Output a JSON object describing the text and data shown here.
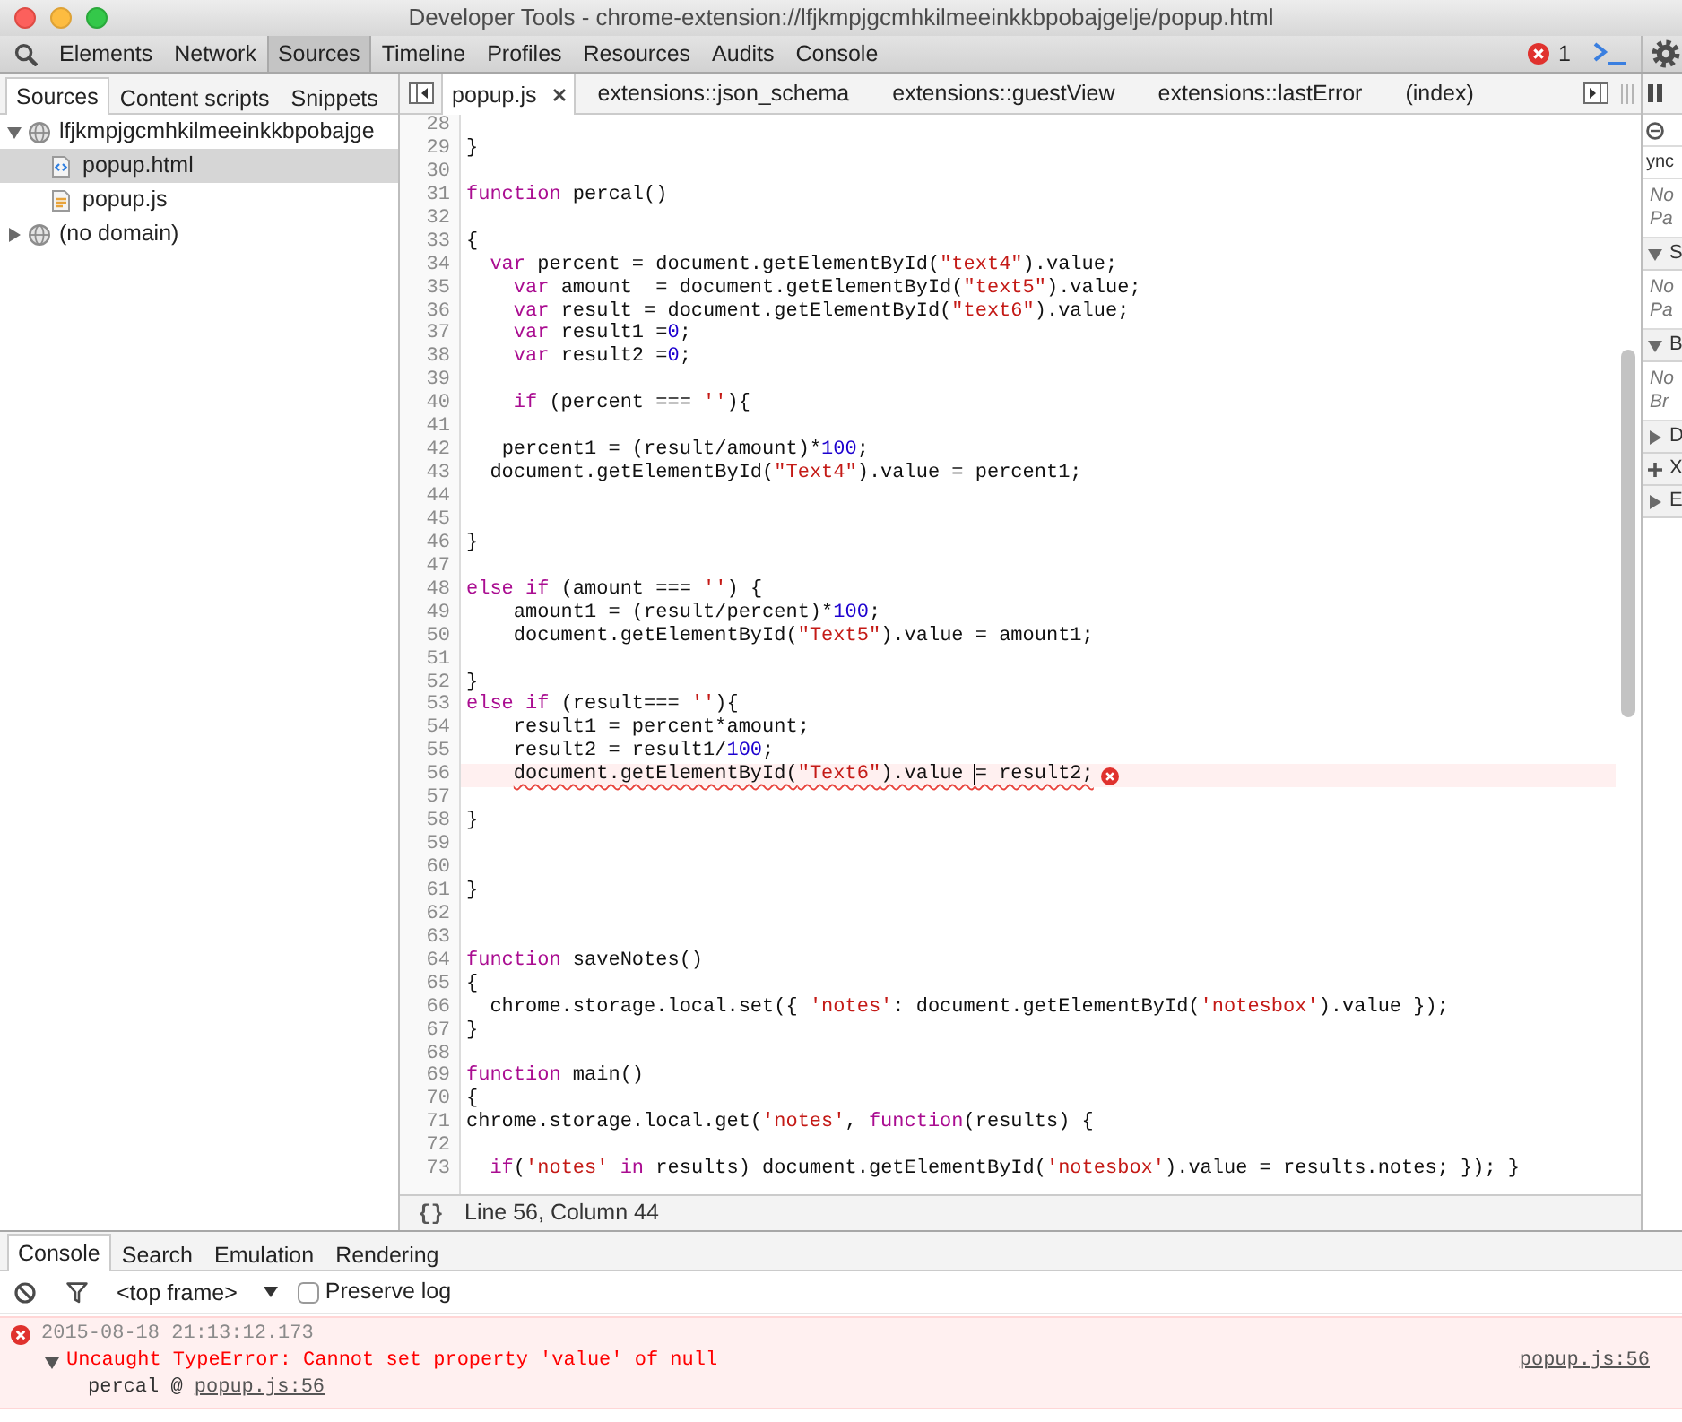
{
  "window": {
    "title": "Developer Tools - chrome-extension://lfjkmpjgcmhkilmeeinkkbpobajgelje/popup.html"
  },
  "toolbar": {
    "tabs": [
      {
        "label": "Elements",
        "selected": false
      },
      {
        "label": "Network",
        "selected": false
      },
      {
        "label": "Sources",
        "selected": true
      },
      {
        "label": "Timeline",
        "selected": false
      },
      {
        "label": "Profiles",
        "selected": false
      },
      {
        "label": "Resources",
        "selected": false
      },
      {
        "label": "Audits",
        "selected": false
      },
      {
        "label": "Console",
        "selected": false
      }
    ],
    "error_count": "1"
  },
  "navigator": {
    "tabs": [
      {
        "label": "Sources",
        "selected": true
      },
      {
        "label": "Content scripts",
        "selected": false
      },
      {
        "label": "Snippets",
        "selected": false
      }
    ],
    "tree": [
      {
        "label": "lfjkmpjgcmhkilmeeinkkbpobajge",
        "kind": "domain",
        "expanded": true,
        "selected": false,
        "children": [
          {
            "label": "popup.html",
            "kind": "html",
            "selected": true
          },
          {
            "label": "popup.js",
            "kind": "script",
            "selected": false
          }
        ]
      },
      {
        "label": "(no domain)",
        "kind": "domain",
        "expanded": false,
        "selected": false
      }
    ]
  },
  "editor": {
    "tabs": [
      {
        "label": "popup.js",
        "selected": true,
        "closable": true
      },
      {
        "label": "extensions::json_schema",
        "selected": false,
        "closable": false
      },
      {
        "label": "extensions::guestView",
        "selected": false,
        "closable": false
      },
      {
        "label": "extensions::lastError",
        "selected": false,
        "closable": false
      },
      {
        "label": "(index)",
        "selected": false,
        "closable": false
      }
    ],
    "lines": [
      {
        "number": "28",
        "error": false
      },
      {
        "number": "29",
        "error": false,
        "tokens": [
          {
            "kind": "plain",
            "text": "}"
          }
        ]
      },
      {
        "number": "30",
        "error": false
      },
      {
        "number": "31",
        "error": false,
        "tokens": [
          {
            "kind": "kw",
            "text": "function"
          },
          {
            "kind": "plain",
            "text": " percal()"
          }
        ]
      },
      {
        "number": "32",
        "error": false
      },
      {
        "number": "33",
        "error": false,
        "tokens": [
          {
            "kind": "plain",
            "text": "{"
          }
        ]
      },
      {
        "number": "34",
        "error": false,
        "tokens": [
          {
            "kind": "kw",
            "text": "  var"
          },
          {
            "kind": "plain",
            "text": " percent = document.getElementById("
          },
          {
            "kind": "str",
            "text": "\"text4\""
          },
          {
            "kind": "plain",
            "text": ").value;"
          }
        ]
      },
      {
        "number": "35",
        "error": false,
        "tokens": [
          {
            "kind": "kw",
            "text": "    var"
          },
          {
            "kind": "plain",
            "text": " amount  = document.getElementById("
          },
          {
            "kind": "str",
            "text": "\"text5\""
          },
          {
            "kind": "plain",
            "text": ").value;"
          }
        ]
      },
      {
        "number": "36",
        "error": false,
        "tokens": [
          {
            "kind": "kw",
            "text": "    var"
          },
          {
            "kind": "plain",
            "text": " result = document.getElementById("
          },
          {
            "kind": "str",
            "text": "\"text6\""
          },
          {
            "kind": "plain",
            "text": ").value;"
          }
        ]
      },
      {
        "number": "37",
        "error": false,
        "tokens": [
          {
            "kind": "kw",
            "text": "    var"
          },
          {
            "kind": "plain",
            "text": " result1 ="
          },
          {
            "kind": "num",
            "text": "0"
          },
          {
            "kind": "plain",
            "text": ";"
          }
        ]
      },
      {
        "number": "38",
        "error": false,
        "tokens": [
          {
            "kind": "kw",
            "text": "    var"
          },
          {
            "kind": "plain",
            "text": " result2 ="
          },
          {
            "kind": "num",
            "text": "0"
          },
          {
            "kind": "plain",
            "text": ";"
          }
        ]
      },
      {
        "number": "39",
        "error": false
      },
      {
        "number": "40",
        "error": false,
        "tokens": [
          {
            "kind": "kw",
            "text": "    if"
          },
          {
            "kind": "plain",
            "text": " (percent === "
          },
          {
            "kind": "str",
            "text": "''"
          },
          {
            "kind": "plain",
            "text": "){"
          }
        ]
      },
      {
        "number": "41",
        "error": false
      },
      {
        "number": "42",
        "error": false,
        "tokens": [
          {
            "kind": "plain",
            "text": "   percent1 = (result/amount)*"
          },
          {
            "kind": "num",
            "text": "100"
          },
          {
            "kind": "plain",
            "text": ";"
          }
        ]
      },
      {
        "number": "43",
        "error": false,
        "tokens": [
          {
            "kind": "plain",
            "text": "  document.getElementById("
          },
          {
            "kind": "str",
            "text": "\"Text4\""
          },
          {
            "kind": "plain",
            "text": ").value = percent1;"
          }
        ]
      },
      {
        "number": "44",
        "error": false
      },
      {
        "number": "45",
        "error": false
      },
      {
        "number": "46",
        "error": false,
        "tokens": [
          {
            "kind": "plain",
            "text": "}"
          }
        ]
      },
      {
        "number": "47",
        "error": false
      },
      {
        "number": "48",
        "error": false,
        "tokens": [
          {
            "kind": "kw",
            "text": "else if"
          },
          {
            "kind": "plain",
            "text": " (amount === "
          },
          {
            "kind": "str",
            "text": "''"
          },
          {
            "kind": "plain",
            "text": ") {"
          }
        ]
      },
      {
        "number": "49",
        "error": false,
        "tokens": [
          {
            "kind": "plain",
            "text": "    amount1 = (result/percent)*"
          },
          {
            "kind": "num",
            "text": "100"
          },
          {
            "kind": "plain",
            "text": ";"
          }
        ]
      },
      {
        "number": "50",
        "error": false,
        "tokens": [
          {
            "kind": "plain",
            "text": "    document.getElementById("
          },
          {
            "kind": "str",
            "text": "\"Text5\""
          },
          {
            "kind": "plain",
            "text": ").value = amount1;"
          }
        ]
      },
      {
        "number": "51",
        "error": false
      },
      {
        "number": "52",
        "error": false,
        "tokens": [
          {
            "kind": "plain",
            "text": "}"
          }
        ]
      },
      {
        "number": "53",
        "error": false,
        "tokens": [
          {
            "kind": "kw",
            "text": "else if"
          },
          {
            "kind": "plain",
            "text": " (result=== "
          },
          {
            "kind": "str",
            "text": "''"
          },
          {
            "kind": "plain",
            "text": "){"
          }
        ]
      },
      {
        "number": "54",
        "error": false,
        "tokens": [
          {
            "kind": "plain",
            "text": "    result1 = percent*amount;"
          }
        ]
      },
      {
        "number": "55",
        "error": false,
        "tokens": [
          {
            "kind": "plain",
            "text": "    result2 = result1/"
          },
          {
            "kind": "num",
            "text": "100"
          },
          {
            "kind": "plain",
            "text": ";"
          }
        ]
      },
      {
        "number": "56",
        "error": true,
        "tokens": [
          {
            "kind": "plain",
            "text": "    document.getElementById("
          },
          {
            "kind": "str",
            "text": "\"Text6\""
          },
          {
            "kind": "plain",
            "text": ").value "
          },
          {
            "kind": "plain",
            "text": "= result2;",
            "cursor": true
          }
        ]
      },
      {
        "number": "57",
        "error": false
      },
      {
        "number": "58",
        "error": false,
        "tokens": [
          {
            "kind": "plain",
            "text": "}"
          }
        ]
      },
      {
        "number": "59",
        "error": false
      },
      {
        "number": "60",
        "error": false
      },
      {
        "number": "61",
        "error": false,
        "tokens": [
          {
            "kind": "plain",
            "text": "}"
          }
        ]
      },
      {
        "number": "62",
        "error": false
      },
      {
        "number": "63",
        "error": false
      },
      {
        "number": "64",
        "error": false,
        "tokens": [
          {
            "kind": "kw",
            "text": "function"
          },
          {
            "kind": "plain",
            "text": " saveNotes()"
          }
        ]
      },
      {
        "number": "65",
        "error": false,
        "tokens": [
          {
            "kind": "plain",
            "text": "{"
          }
        ]
      },
      {
        "number": "66",
        "error": false,
        "tokens": [
          {
            "kind": "plain",
            "text": "  chrome.storage.local.set({ "
          },
          {
            "kind": "str",
            "text": "'notes'"
          },
          {
            "kind": "plain",
            "text": ": document.getElementById("
          },
          {
            "kind": "str",
            "text": "'notesbox'"
          },
          {
            "kind": "plain",
            "text": ").value });"
          }
        ]
      },
      {
        "number": "67",
        "error": false,
        "tokens": [
          {
            "kind": "plain",
            "text": "}"
          }
        ]
      },
      {
        "number": "68",
        "error": false
      },
      {
        "number": "69",
        "error": false,
        "tokens": [
          {
            "kind": "kw",
            "text": "function"
          },
          {
            "kind": "plain",
            "text": " main()"
          }
        ]
      },
      {
        "number": "70",
        "error": false,
        "tokens": [
          {
            "kind": "plain",
            "text": "{"
          }
        ]
      },
      {
        "number": "71",
        "error": false,
        "tokens": [
          {
            "kind": "plain",
            "text": "chrome.storage.local.get("
          },
          {
            "kind": "str",
            "text": "'notes'"
          },
          {
            "kind": "plain",
            "text": ", "
          },
          {
            "kind": "kw",
            "text": "function"
          },
          {
            "kind": "plain",
            "text": "(results) {"
          }
        ]
      },
      {
        "number": "72",
        "error": false
      },
      {
        "number": "73",
        "error": false,
        "tokens": [
          {
            "kind": "kw",
            "text": "  if"
          },
          {
            "kind": "plain",
            "text": "("
          },
          {
            "kind": "str",
            "text": "'notes'"
          },
          {
            "kind": "kw",
            "text": " in"
          },
          {
            "kind": "plain",
            "text": " results) document.getElementById("
          },
          {
            "kind": "str",
            "text": "'notesbox'"
          },
          {
            "kind": "plain",
            "text": ").value = results.notes; }); }"
          }
        ]
      }
    ],
    "format_button": "{}",
    "status": "Line 56, Column 44"
  },
  "sidebar": {
    "rows": [
      {
        "kind": "icon"
      },
      {
        "kind": "label",
        "text": "ync"
      },
      {
        "kind": "note",
        "lines": [
          "No",
          "Pa"
        ]
      },
      {
        "kind": "section",
        "expanded": true,
        "text": "S"
      },
      {
        "kind": "note",
        "lines": [
          "No",
          "Pa"
        ]
      },
      {
        "kind": "section",
        "expanded": true,
        "text": "B"
      },
      {
        "kind": "note",
        "lines": [
          "No",
          "Br"
        ]
      },
      {
        "kind": "section",
        "expanded": false,
        "text": "D"
      },
      {
        "kind": "add_section",
        "text": "X"
      },
      {
        "kind": "section",
        "expanded": false,
        "text": "E"
      }
    ]
  },
  "drawer": {
    "tabs": [
      {
        "label": "Console",
        "selected": true
      },
      {
        "label": "Search",
        "selected": false
      },
      {
        "label": "Emulation",
        "selected": false
      },
      {
        "label": "Rendering",
        "selected": false
      }
    ],
    "frame": "<top frame>",
    "preserve_log": {
      "label": "Preserve log",
      "checked": false
    },
    "messages": [
      {
        "kind": "error",
        "timestamp": "2015-08-18 21:13:12.173",
        "expanded": true,
        "text": "Uncaught TypeError: Cannot set property 'value' of null",
        "source": "popup.js:56",
        "stack": [
          {
            "text": "percal @",
            "link": "popup.js:56"
          }
        ]
      }
    ]
  }
}
